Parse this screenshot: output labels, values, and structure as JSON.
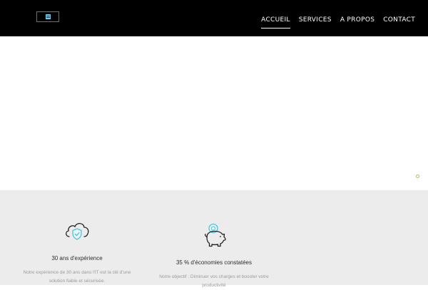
{
  "nav": {
    "items": [
      {
        "label": "ACCUEIL",
        "active": true
      },
      {
        "label": "SERVICES",
        "active": false
      },
      {
        "label": "A PROPOS",
        "active": false
      },
      {
        "label": "CONTACT",
        "active": false
      }
    ]
  },
  "features": [
    {
      "icon": "cloud-shield-icon",
      "title": "30 ans d'expérience",
      "text_line1": "Notre expérience de 30 ans dans l'IT est la clé d'une",
      "text_line2": "solution fiable et sécurisée."
    },
    {
      "icon": "piggy-bank-icon",
      "title": "35 % d'économies constatées",
      "text_line1": "Notre objectif : Diminuer vos charges et booster votre",
      "text_line2": "productivité"
    }
  ],
  "colors": {
    "header_bg": "#000000",
    "features_bg": "#ececec",
    "accent_teal": "#4fc3d8",
    "slider_dot": "#a8c73b"
  }
}
